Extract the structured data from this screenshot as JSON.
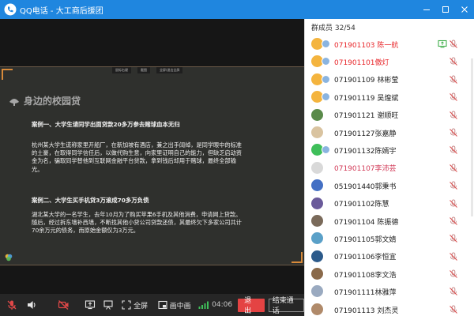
{
  "window": {
    "title": "QQ电话 - 大工商后援团",
    "colors": {
      "titlebar": "#1f86df",
      "accent_red": "#e8262a"
    }
  },
  "slide": {
    "toolbar": [
      "鼠标右键",
      "截图",
      "全屏/退出全屏"
    ],
    "brand": "身边的校园贷",
    "case1_title": "案例一、大学生请同学出面贷款20多万参去赌球血本无归",
    "case1_body": "杭州某大学生谎称家里开船厂，在新加坡有酒店，兼之出手阔绰，是同学眼中的标准的土豪，在取得同学信任后，以做代购生意，向家里证明自己的能力，但缺乏启动资金为名，骗取同学替他到互联网金融平台贷款，拿到钱后却用于赌球，最终全部输光。",
    "case2_title": "案例二、大学生买手机贷3万滚成70多万负债",
    "case2_body": "湖北某大学的一名学生，去年10月为了购买苹果6手机及其他消费，申请网上贷款。随后，经过拆东墙补西墙，不断找其他小贷公司贷款还债，其最终欠下多家公司共计70余万元的债务，而原始金额仅为3万元。"
  },
  "controls": {
    "fullscreen": "全屏",
    "pip": "画中画",
    "timer": "04:06",
    "exit": "退出",
    "end_call": "结束通话"
  },
  "panel": {
    "header": "群成员 32/54",
    "members": [
      {
        "name": "071901103 陈一航",
        "style": "red",
        "avatar": "#f4b43e",
        "mini": true,
        "screen": true
      },
      {
        "name": "071901101傲灯",
        "style": "red",
        "avatar": "#f4b43e",
        "mini": true,
        "screen": false
      },
      {
        "name": "071901109 林彬莹",
        "style": "normal",
        "avatar": "#f4b43e",
        "mini": true,
        "screen": false
      },
      {
        "name": "071901119 吴煌斌",
        "style": "normal",
        "avatar": "#f4b43e",
        "mini": true,
        "screen": false
      },
      {
        "name": "071901121 谢顺旺",
        "style": "normal",
        "avatar": "#5a8a4a",
        "mini": false,
        "screen": false
      },
      {
        "name": "071901127张嘉静",
        "style": "normal",
        "avatar": "#d9c3a0",
        "mini": false,
        "screen": false
      },
      {
        "name": "071901132陈嫣宇",
        "style": "normal",
        "avatar": "#3fbf5a",
        "mini": true,
        "screen": false
      },
      {
        "name": "071901107李沛芸",
        "style": "purple",
        "avatar": "#d9d9d9",
        "mini": false,
        "screen": false
      },
      {
        "name": "051901440郭秉书",
        "style": "normal",
        "avatar": "#4470c4",
        "mini": false,
        "screen": false
      },
      {
        "name": "071901102陈慧",
        "style": "normal",
        "avatar": "#6a5a9a",
        "mini": false,
        "screen": false
      },
      {
        "name": "071901104 陈振德",
        "style": "normal",
        "avatar": "#7a6a5a",
        "mini": false,
        "screen": false
      },
      {
        "name": "071901105郭文婧",
        "style": "normal",
        "avatar": "#5aa0c8",
        "mini": false,
        "screen": false
      },
      {
        "name": "071901106李恒宜",
        "style": "normal",
        "avatar": "#2c5a8a",
        "mini": false,
        "screen": false
      },
      {
        "name": "071901108李文浩",
        "style": "normal",
        "avatar": "#8a6a4a",
        "mini": false,
        "screen": false
      },
      {
        "name": "071901111林雅萍",
        "style": "normal",
        "avatar": "#9aaac0",
        "mini": false,
        "screen": false
      },
      {
        "name": "071901113 刘杰灵",
        "style": "normal",
        "avatar": "#b08a6a",
        "mini": false,
        "screen": false
      }
    ]
  }
}
